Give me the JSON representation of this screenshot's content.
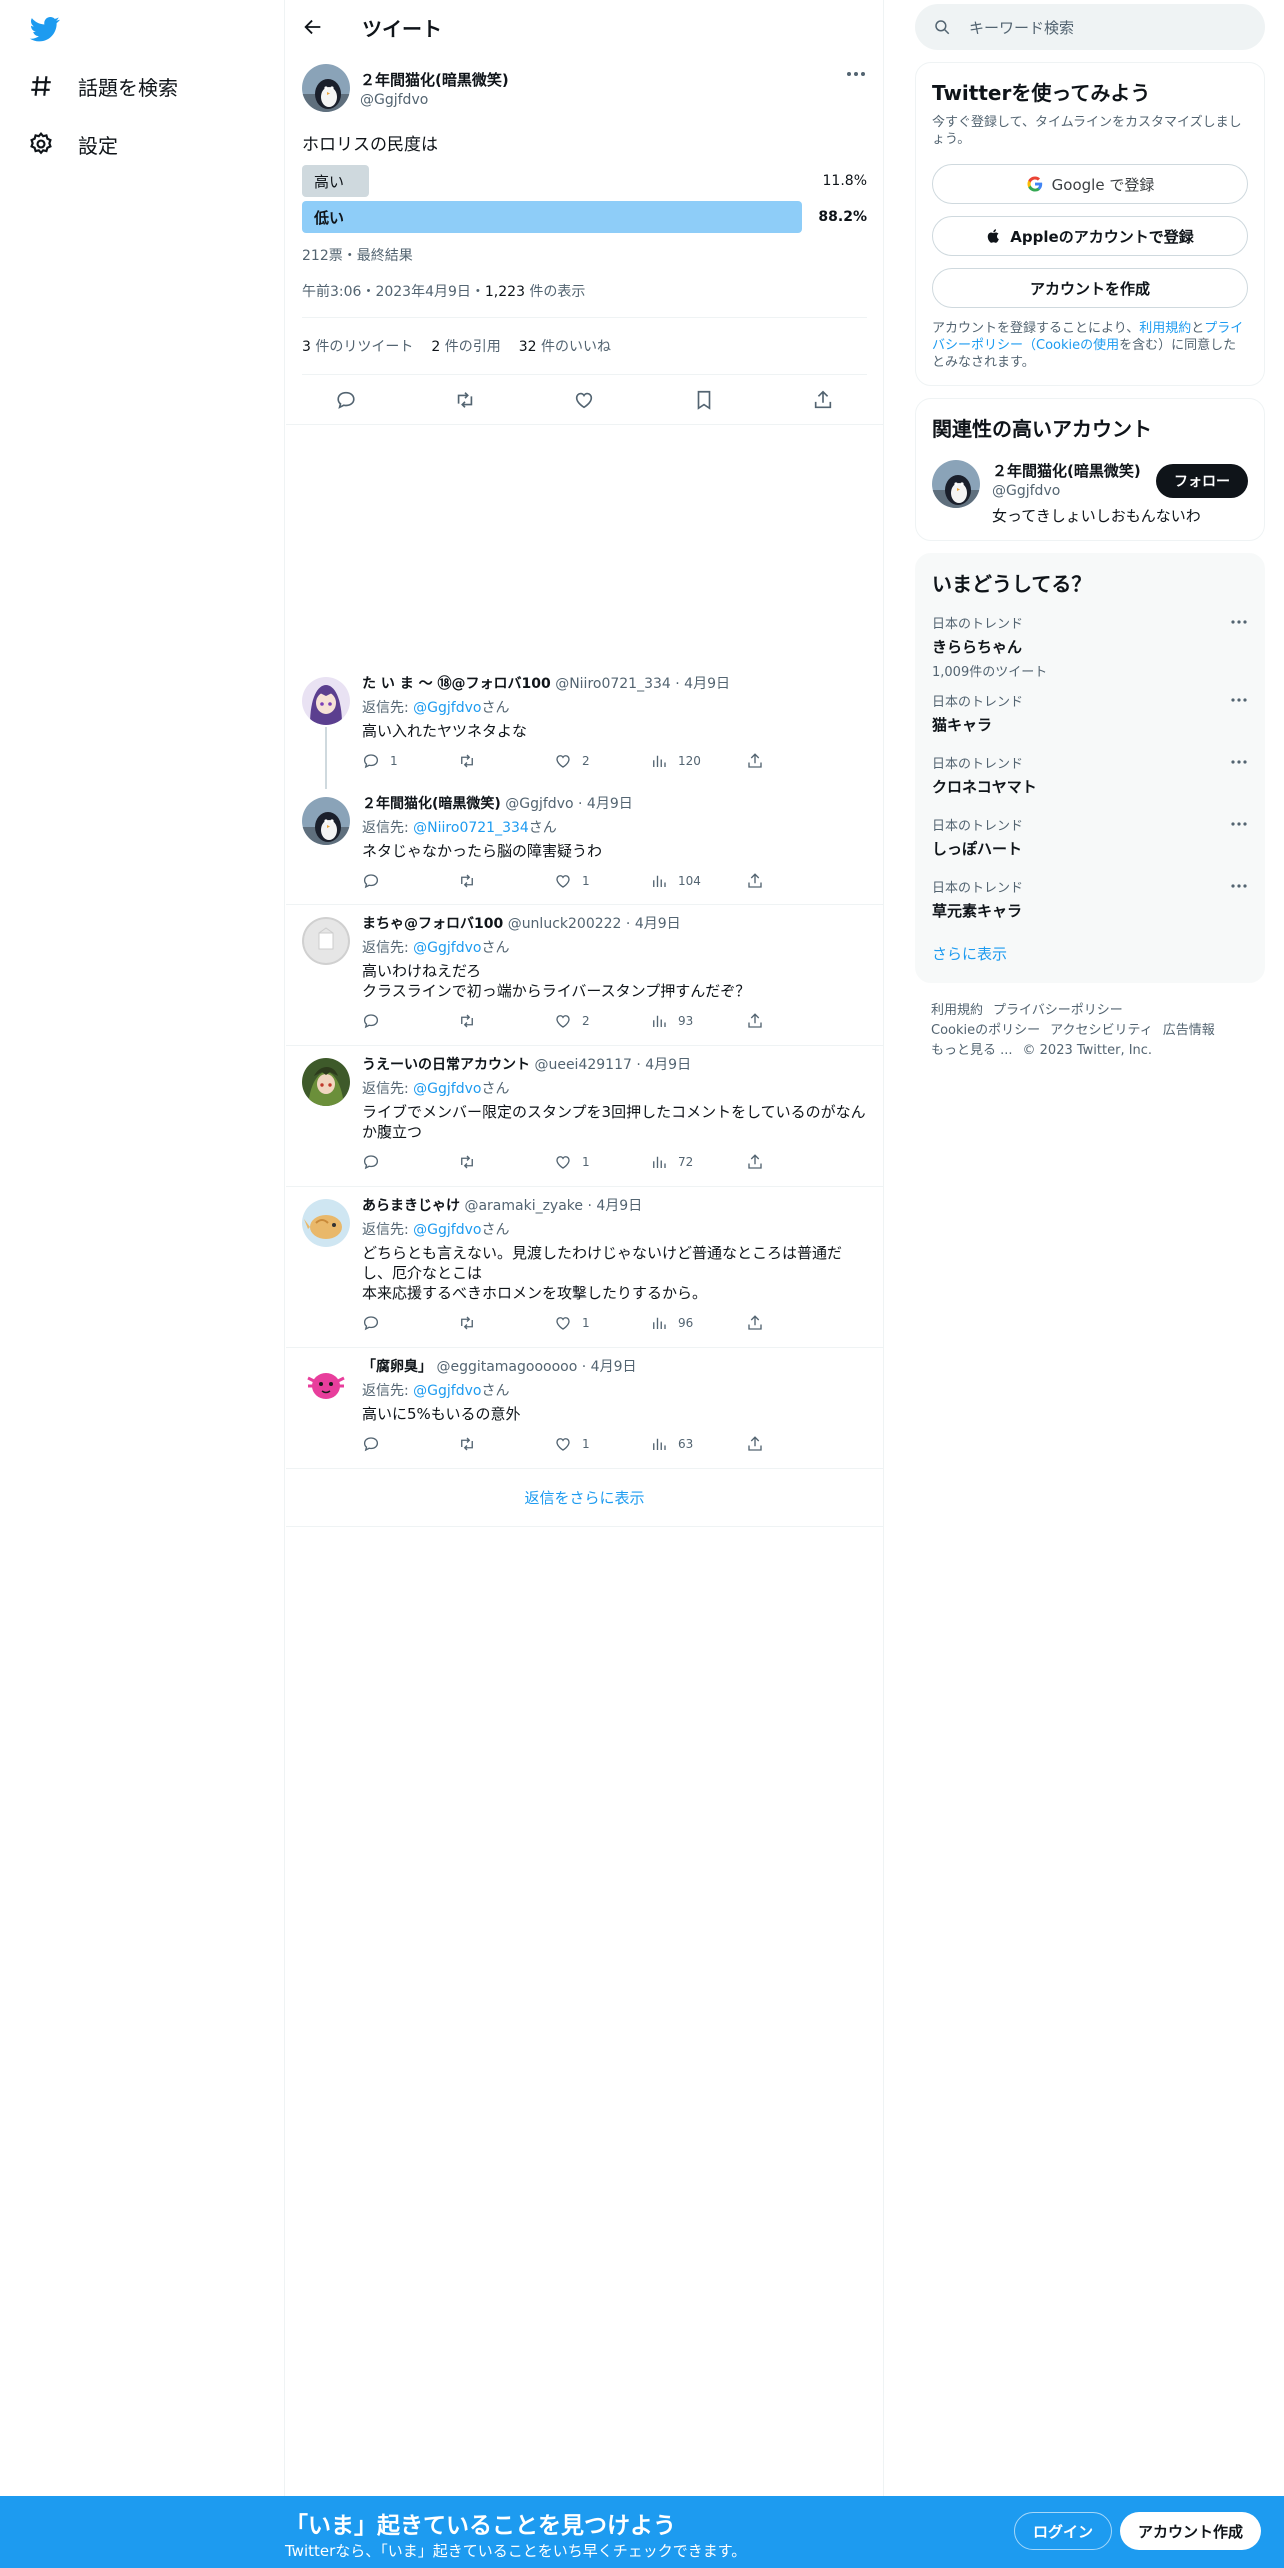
{
  "sidebar": {
    "items": [
      {
        "label": "話題を検索",
        "icon": "hashtag-icon"
      },
      {
        "label": "設定",
        "icon": "gear-icon"
      }
    ]
  },
  "header": {
    "title": "ツイート"
  },
  "tweet": {
    "author_name": "２年間猫化(暗黒微笑)",
    "author_handle": "@Ggjfdvo",
    "text": "ホロリスの民度は",
    "poll": {
      "options": [
        {
          "label": "高い",
          "percent_text": "11.8%",
          "percent": 11.8,
          "winner": false
        },
        {
          "label": "低い",
          "percent_text": "88.2%",
          "percent": 88.2,
          "winner": true
        }
      ],
      "meta": "212票・最終結果"
    },
    "timestamp": "午前3:06・2023年4月9日・",
    "views": "1,223",
    "views_label": " 件の表示",
    "stats": {
      "retweets": "3",
      "retweets_label": " 件のリツイート",
      "quotes": "2",
      "quotes_label": " 件の引用",
      "likes": "32",
      "likes_label": " 件のいいね"
    }
  },
  "replies": [
    {
      "name": "た い ま ～ ⑱@フォロバ100",
      "handle": "@Niiro0721_334",
      "date": "4月9日",
      "reply_prefix": "返信先: ",
      "to": "@Ggjfdvo",
      "to_suffix": "さん",
      "text": "高い入れたヤツネタよな",
      "replies": "1",
      "retweets": "",
      "likes": "2",
      "views": "120"
    },
    {
      "name": "２年間猫化(暗黒微笑)",
      "handle": "@Ggjfdvo",
      "date": "4月9日",
      "reply_prefix": "返信先: ",
      "to": "@Niiro0721_334",
      "to_suffix": "さん",
      "text": "ネタじゃなかったら脳の障害疑うわ",
      "replies": "",
      "retweets": "",
      "likes": "1",
      "views": "104"
    },
    {
      "name": "まちゃ@フォロバ100",
      "handle": "@unluck200222",
      "date": "4月9日",
      "reply_prefix": "返信先: ",
      "to": "@Ggjfdvo",
      "to_suffix": "さん",
      "text": "高いわけねえだろ\nクラスラインで初っ端からライバースタンプ押すんだぞ？",
      "replies": "",
      "retweets": "",
      "likes": "2",
      "views": "93"
    },
    {
      "name": "うえーいの日常アカウント",
      "handle": "@ueei429117",
      "date": "4月9日",
      "reply_prefix": "返信先: ",
      "to": "@Ggjfdvo",
      "to_suffix": "さん",
      "text": "ライブでメンバー限定のスタンプを3回押したコメントをしているのがなんか腹立つ",
      "replies": "",
      "retweets": "",
      "likes": "1",
      "views": "72"
    },
    {
      "name": "あらまきじゃけ",
      "handle": "@aramaki_zyake",
      "date": "4月9日",
      "reply_prefix": "返信先: ",
      "to": "@Ggjfdvo",
      "to_suffix": "さん",
      "text": "どちらとも言えない。見渡したわけじゃないけど普通なところは普通だし、厄介なとこは\n本来応援するべきホロメンを攻撃したりするから。",
      "replies": "",
      "retweets": "",
      "likes": "1",
      "views": "96"
    },
    {
      "name": "「腐卵臭」",
      "handle": "@eggitamagoooooo",
      "date": "4月9日",
      "reply_prefix": "返信先: ",
      "to": "@Ggjfdvo",
      "to_suffix": "さん",
      "text": "高いに5%もいるの意外",
      "replies": "",
      "retweets": "",
      "likes": "1",
      "views": "63"
    }
  ],
  "show_more_replies": "返信をさらに表示",
  "search": {
    "placeholder": "キーワード検索"
  },
  "signup_card": {
    "title": "Twitterを使ってみよう",
    "subtitle": "今すぐ登録して、タイムラインをカスタマイズしましょう。",
    "google": "Google で登録",
    "apple": "Appleのアカウントで登録",
    "create": "アカウントを作成",
    "legal_1": "アカウントを登録することにより、",
    "legal_terms": "利用規約",
    "legal_2": "と",
    "legal_privacy": "プライバシーポリシー（Cookieの使用",
    "legal_3": "を含む）に同意したとみなされます。"
  },
  "related": {
    "title": "関連性の高いアカウント",
    "name": "２年間猫化(暗黒微笑)",
    "handle": "@Ggjfdvo",
    "bio": "女ってきしょいしおもんないわ",
    "follow": "フォロー"
  },
  "trends": {
    "title": "いまどうしてる？",
    "items": [
      {
        "category": "日本のトレンド",
        "name": "きららちゃん",
        "count": "1,009件のツイート"
      },
      {
        "category": "日本のトレンド",
        "name": "猫キャラ",
        "count": ""
      },
      {
        "category": "日本のトレンド",
        "name": "クロネコヤマト",
        "count": ""
      },
      {
        "category": "日本のトレンド",
        "name": "しっぽハート",
        "count": ""
      },
      {
        "category": "日本のトレンド",
        "name": "草元素キャラ",
        "count": ""
      }
    ],
    "show_more": "さらに表示"
  },
  "footer": {
    "terms": "利用規約",
    "privacy": "プライバシーポリシー",
    "cookie": "Cookieのポリシー",
    "accessibility": "アクセシビリティ",
    "ads": "広告情報",
    "more": "もっと見る ...",
    "copyright": "© 2023 Twitter, Inc."
  },
  "banner": {
    "title": "「いま」起きていることを見つけよう",
    "subtitle": "Twitterなら、「いま」起きていることをいち早くチェックできます。",
    "login": "ログイン",
    "signup": "アカウント作成"
  },
  "colors": {
    "accent": "#1d9bf0",
    "poll_winner": "#8ecdf8",
    "poll_other": "#cfd9de",
    "banner": "#1d9bf0"
  }
}
